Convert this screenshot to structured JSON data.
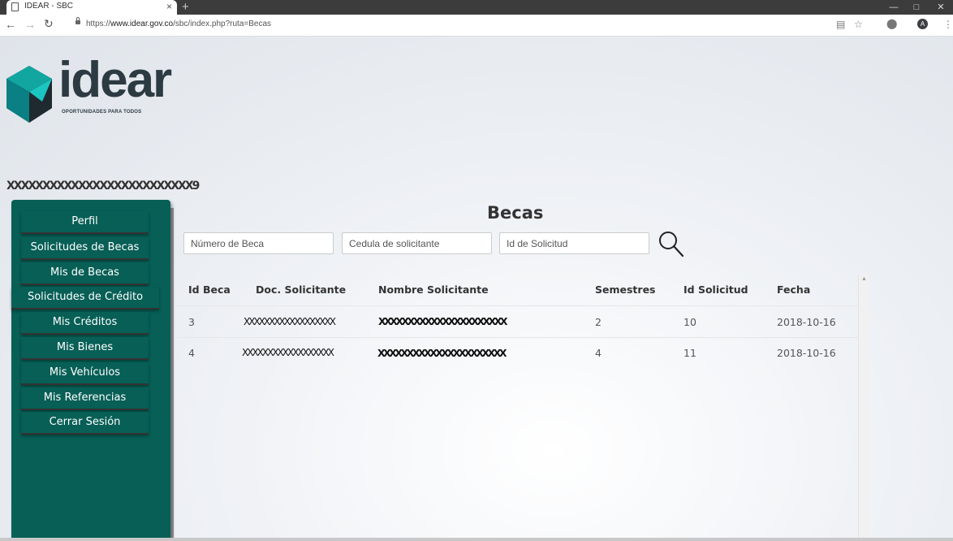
{
  "browser": {
    "tab_title": "IDEAR - SBC",
    "tab_close": "×",
    "new_tab": "+",
    "url_scheme": "https://",
    "url_host": "www.idear.gov.co",
    "url_path": "/sbc/index.php?ruta=Becas",
    "avatar_letter": "A"
  },
  "brand": {
    "name": "idear",
    "tagline": "OPORTUNIDADES PARA TODOS",
    "colors": {
      "primary": "#075f56",
      "gem_dark": "#1f2a30",
      "gem_teal": "#12a6a0"
    }
  },
  "user": {
    "name": "XXXXXXXXXXXXXXXXXXXXXXXXXX9"
  },
  "sidebar": {
    "items": [
      {
        "label": "Perfil"
      },
      {
        "label": "Solicitudes de Becas"
      },
      {
        "label": "Mis de Becas"
      },
      {
        "label": "Solicitudes de Crédito"
      },
      {
        "label": "Mis Créditos"
      },
      {
        "label": "Mis Bienes"
      },
      {
        "label": "Mis Vehículos"
      },
      {
        "label": "Mis Referencias"
      },
      {
        "label": "Cerrar Sesión"
      }
    ]
  },
  "main": {
    "title": "Becas",
    "search": {
      "numero_placeholder": "Número de Beca",
      "cedula_placeholder": "Cedula de solicitante",
      "id_placeholder": "Id de Solicitud"
    },
    "table": {
      "headers": [
        "Id Beca",
        "Doc. Solicitante",
        "Nombre Solicitante",
        "Semestres",
        "Id Solicitud",
        "Fecha"
      ],
      "rows": [
        {
          "id_beca": "3",
          "doc": "XXXXXXXXXXXXXXXXXX",
          "nombre": "XXXXXXXXXXXXXXXXXXXXXX",
          "semestres": "2",
          "id_solicitud": "10",
          "fecha": "2018-10-16"
        },
        {
          "id_beca": "4",
          "doc": "XXXXXXXXXXXXXXXXXX",
          "nombre": "XXXXXXXXXXXXXXXXXXXXXX",
          "semestres": "4",
          "id_solicitud": "11",
          "fecha": "2018-10-16"
        }
      ]
    }
  }
}
